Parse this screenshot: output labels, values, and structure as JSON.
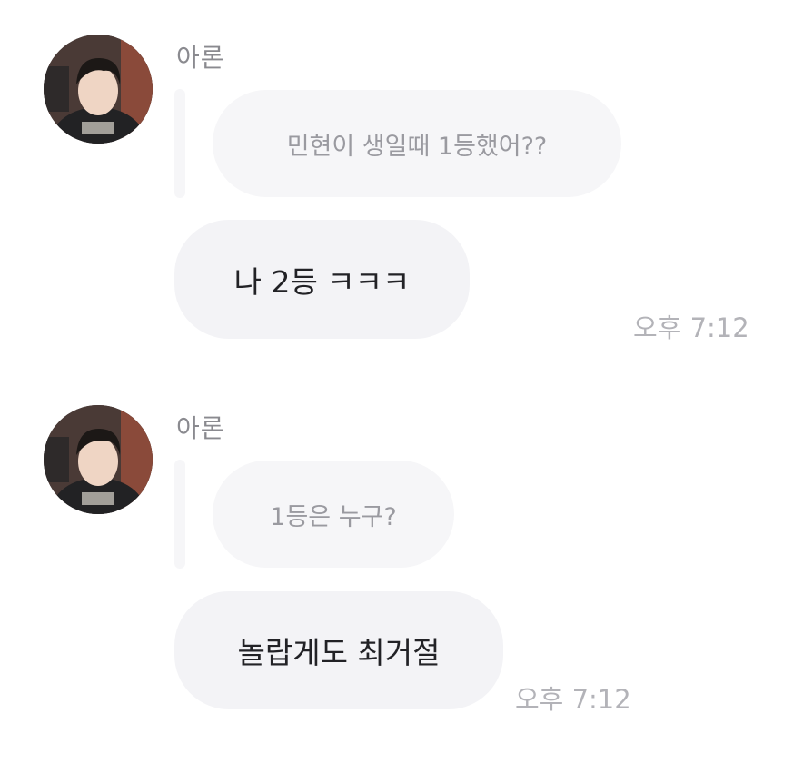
{
  "messages": [
    {
      "sender": "아론",
      "quoted_text": "민현이 생일때 1등했어??",
      "text": "나 2등 ㅋㅋㅋ",
      "time": "오후 7:12"
    },
    {
      "sender": "아론",
      "quoted_text": "1등은 누구?",
      "text": "놀랍게도 최거절",
      "time": "오후 7:12"
    }
  ],
  "colors": {
    "main_bubble": "#f3f3f6",
    "quoted_bubble": "#f6f6f8",
    "sender_text": "#8a8a8f",
    "time_text": "#b3b3b8"
  }
}
